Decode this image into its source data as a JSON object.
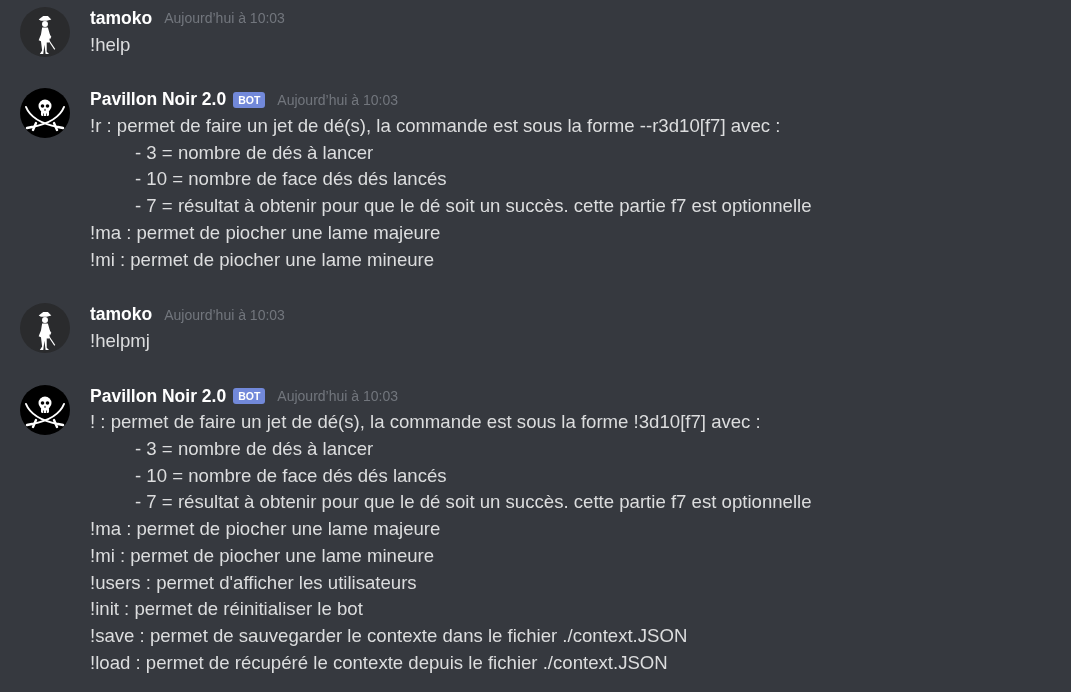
{
  "messages": [
    {
      "kind": "user",
      "author": "tamoko",
      "timestamp": "Aujourd’hui à 10:03",
      "lines": [
        {
          "text": "!help"
        }
      ]
    },
    {
      "kind": "bot",
      "author": "Pavillon Noir 2.0",
      "badge": "BOT",
      "timestamp": "Aujourd’hui à 10:03",
      "lines": [
        {
          "text": "!r : permet de faire un jet de dé(s), la commande est sous la forme --r3d10[f7] avec :",
          "children": [
            {
              "text": "- 3 = nombre de dés à lancer"
            },
            {
              "text": "- 10 = nombre de face dés dés lancés"
            },
            {
              "text": "- 7 = résultat à obtenir pour que le dé soit un succès. cette partie f7 est optionnelle"
            }
          ]
        },
        {
          "text": "!ma : permet de piocher une lame majeure"
        },
        {
          "text": "!mi : permet de piocher une lame mineure"
        }
      ]
    },
    {
      "kind": "user",
      "author": "tamoko",
      "timestamp": "Aujourd’hui à 10:03",
      "lines": [
        {
          "text": "!helpmj"
        }
      ]
    },
    {
      "kind": "bot",
      "author": "Pavillon Noir 2.0",
      "badge": "BOT",
      "timestamp": "Aujourd’hui à 10:03",
      "lines": [
        {
          "text": "! : permet de faire un jet de dé(s), la commande est sous la forme !3d10[f7] avec :",
          "children": [
            {
              "text": "- 3 = nombre de dés à lancer"
            },
            {
              "text": "- 10 = nombre de face dés dés lancés"
            },
            {
              "text": "- 7 = résultat à obtenir pour que le dé soit un succès. cette partie f7 est optionnelle"
            }
          ]
        },
        {
          "text": "!ma : permet de piocher une lame majeure"
        },
        {
          "text": "!mi : permet de piocher une lame mineure"
        },
        {
          "text": "!users : permet d'afficher les utilisateurs"
        },
        {
          "text": "!init : permet de réinitialiser le bot"
        },
        {
          "text": "!save : permet de sauvegarder le contexte dans le fichier ./context.JSON"
        },
        {
          "text": "!load : permet de récupéré le contexte depuis le fichier ./context.JSON"
        }
      ]
    }
  ]
}
